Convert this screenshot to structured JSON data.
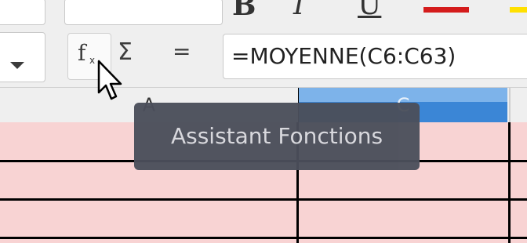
{
  "toolbar": {
    "font_style": {
      "bold_glyph": "B",
      "italic_glyph": "I",
      "underline_glyph": "U"
    },
    "font_color": "#d41c1c",
    "highlight_color": "#ffe000"
  },
  "formula_bar": {
    "function_wizard": {
      "glyph": "f",
      "sub_glyph": "x"
    },
    "sum_glyph": "Σ",
    "equals_glyph": "=",
    "formula": "=MOYENNE(C6:C63)"
  },
  "columns": {
    "a": "A",
    "c": "C"
  },
  "tooltip": {
    "text": "Assistant Fonctions"
  },
  "colors": {
    "cell_fill": "#f8d3d3",
    "selected_header": "#3b86d6",
    "tooltip_bg": "#4b4f5b"
  }
}
